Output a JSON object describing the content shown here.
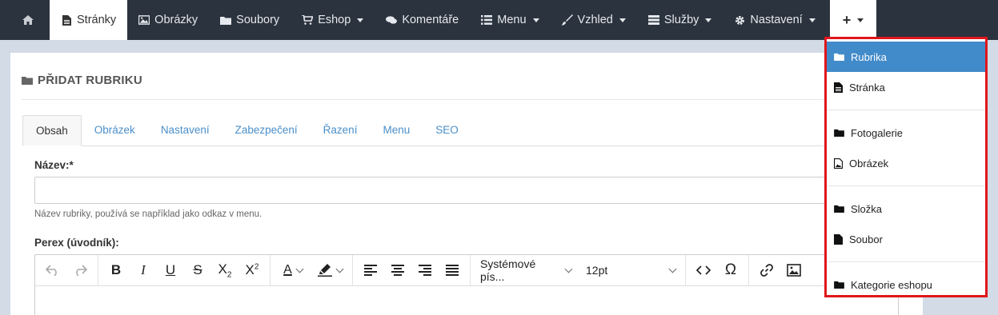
{
  "navbar": {
    "items": [
      {
        "label": "Stránky"
      },
      {
        "label": "Obrázky"
      },
      {
        "label": "Soubory"
      },
      {
        "label": "Eshop"
      },
      {
        "label": "Komentáře"
      },
      {
        "label": "Menu"
      },
      {
        "label": "Vzhled"
      },
      {
        "label": "Služby"
      },
      {
        "label": "Nastavení"
      }
    ],
    "plus_label": "+"
  },
  "panel": {
    "title": "PŘIDAT RUBRIKU"
  },
  "tabs": [
    {
      "label": "Obsah"
    },
    {
      "label": "Obrázek"
    },
    {
      "label": "Nastavení"
    },
    {
      "label": "Zabezpečení"
    },
    {
      "label": "Řazení"
    },
    {
      "label": "Menu"
    },
    {
      "label": "SEO"
    }
  ],
  "form": {
    "name_label": "Název:*",
    "name_value": "",
    "name_help": "Název rubriky, používá se například jako odkaz v menu.",
    "perex_label": "Perex (úvodník):"
  },
  "editor": {
    "font_family": "Systémové pís...",
    "font_size": "12pt"
  },
  "dropdown": {
    "items": [
      {
        "label": "Rubrika",
        "icon": "folder-icon"
      },
      {
        "label": "Stránka",
        "icon": "file-text-icon"
      },
      {
        "label": "Fotogalerie",
        "icon": "folder-icon"
      },
      {
        "label": "Obrázek",
        "icon": "image-file-icon"
      },
      {
        "label": "Složka",
        "icon": "folder-icon"
      },
      {
        "label": "Soubor",
        "icon": "file-icon"
      },
      {
        "label": "Kategorie eshopu",
        "icon": "folder-icon"
      }
    ]
  },
  "colors": {
    "navbar_bg": "#2b333e",
    "accent": "#428bca",
    "highlight_border": "#e0161b"
  }
}
